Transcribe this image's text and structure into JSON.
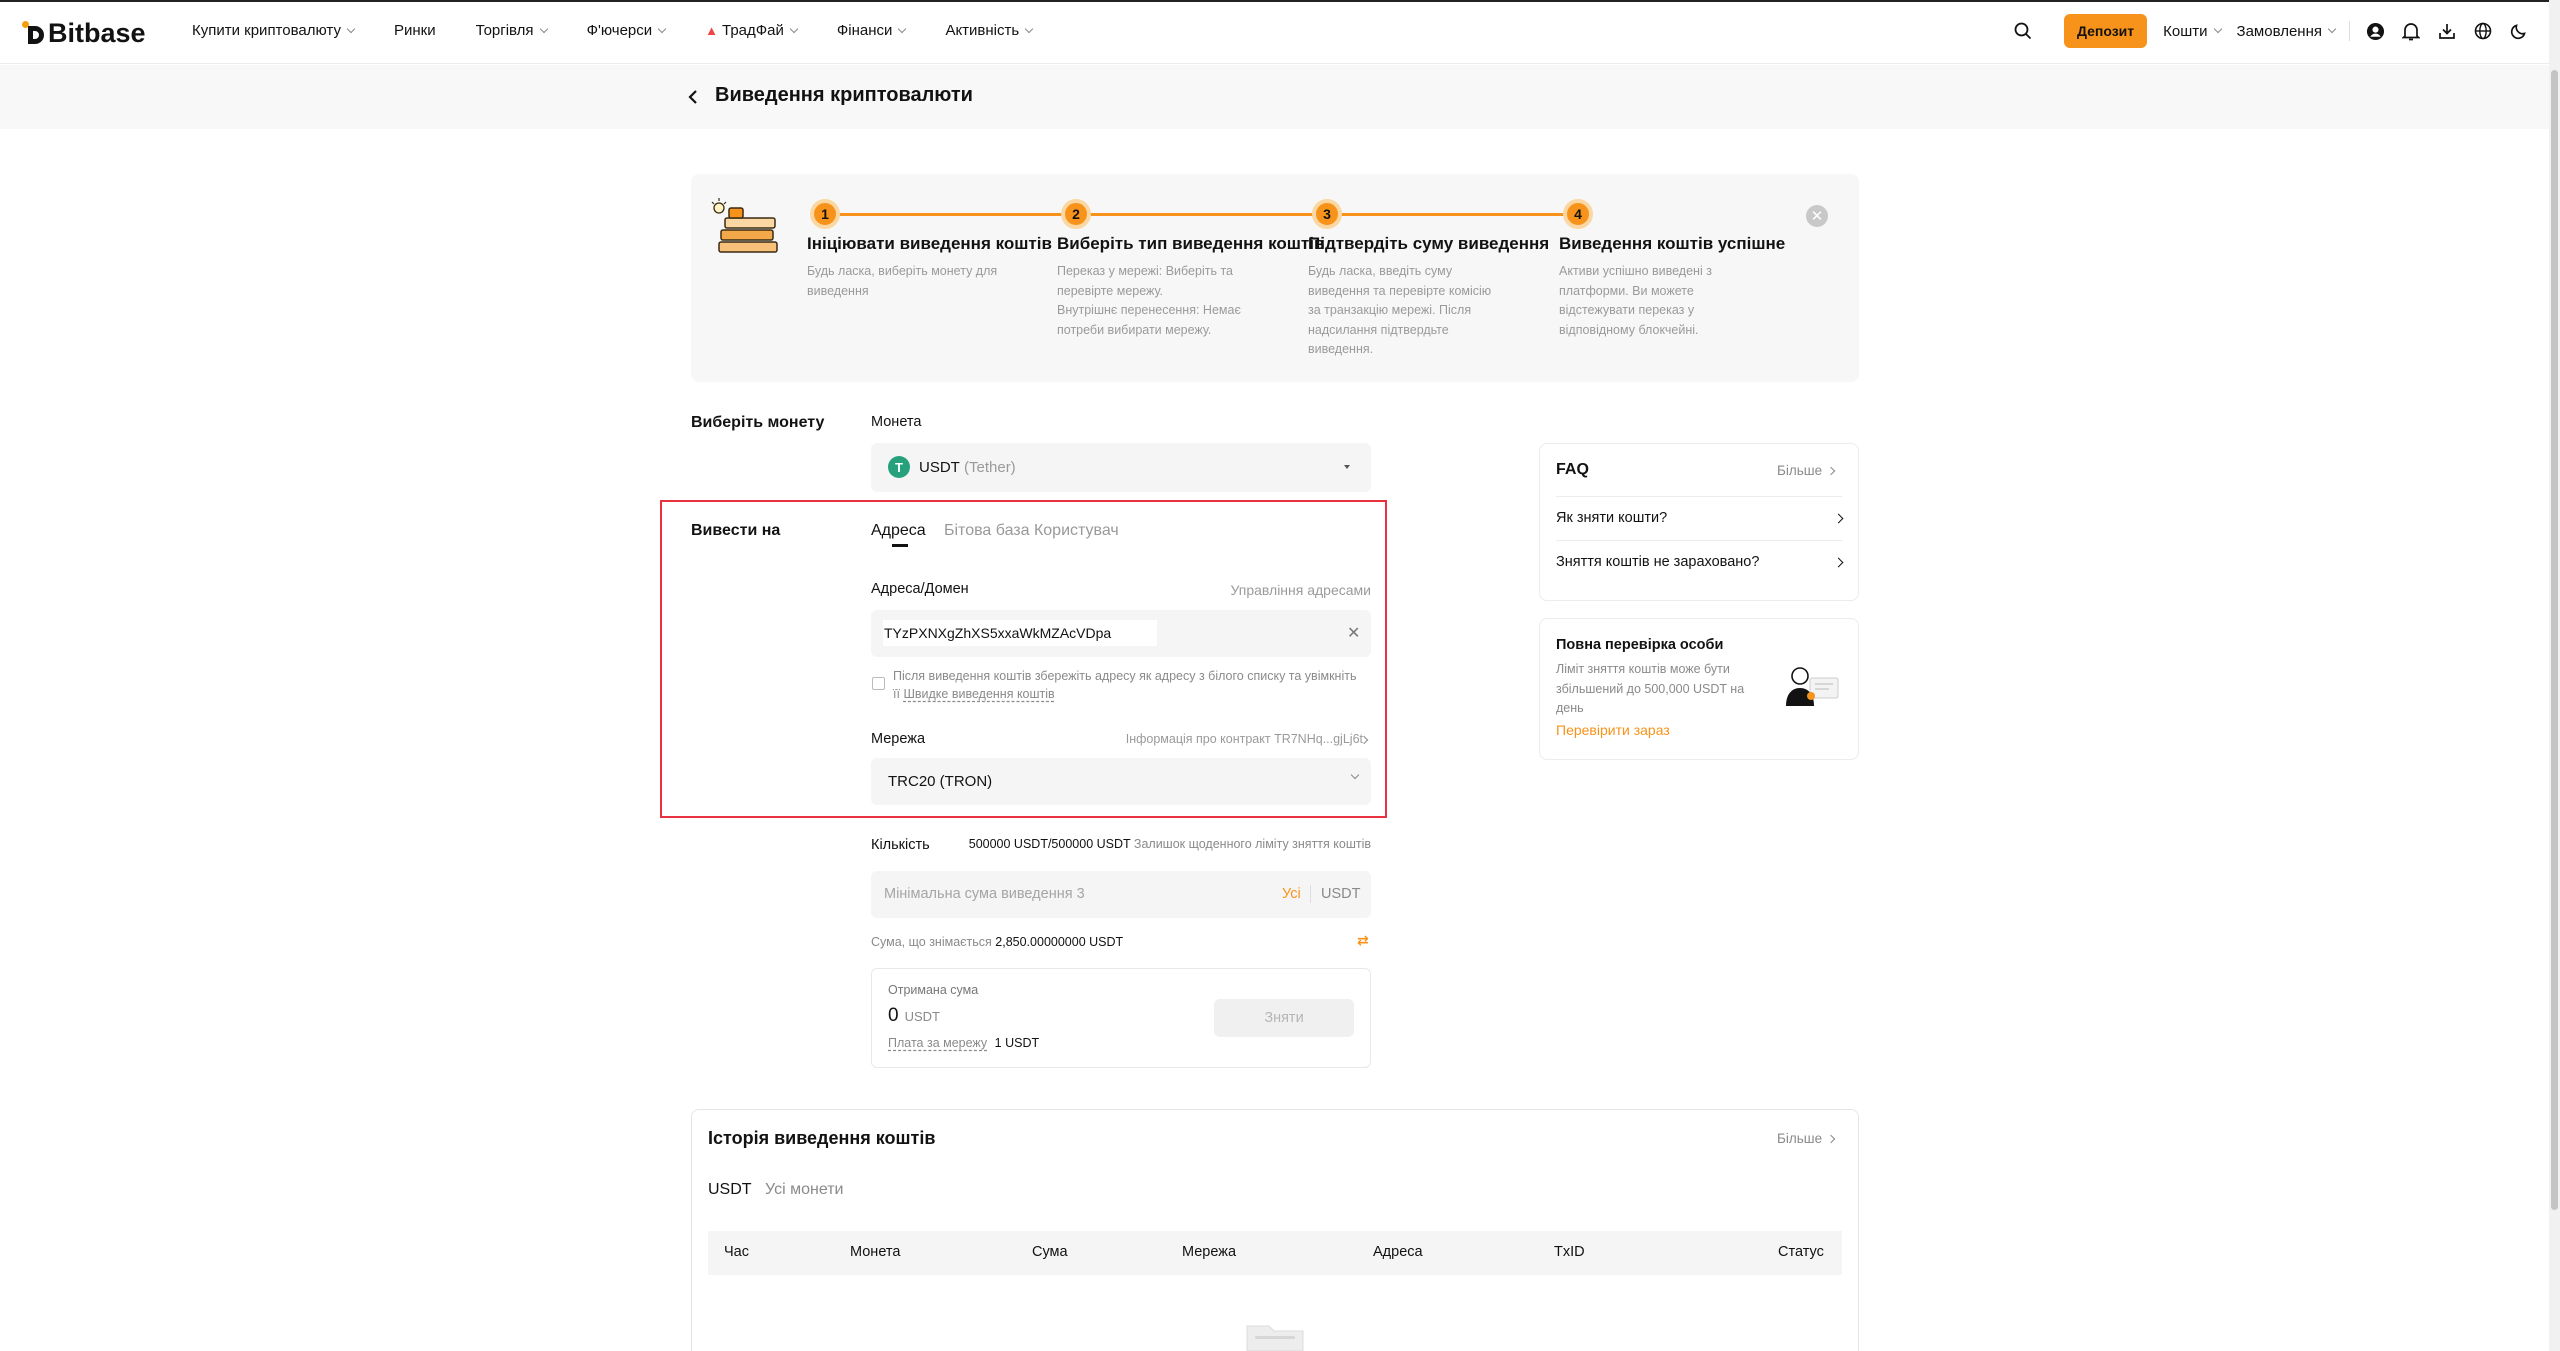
{
  "brand": {
    "name": "Bitbase"
  },
  "nav": {
    "items": [
      {
        "label": "Купити криптовалюту",
        "caret": true
      },
      {
        "label": "Ринки",
        "caret": false
      },
      {
        "label": "Торгівля",
        "caret": true
      },
      {
        "label": "Ф'ючерси",
        "caret": true
      },
      {
        "label": "ТрадФай",
        "caret": true
      },
      {
        "label": "Фінанси",
        "caret": true
      },
      {
        "label": "Активність",
        "caret": true
      }
    ],
    "deposit_label": "Депозит",
    "funds_label": "Кошти",
    "orders_label": "Замовлення"
  },
  "page": {
    "title": "Виведення криптовалюти"
  },
  "steps": [
    {
      "num": "1",
      "title": "Ініціювати виведення коштів",
      "desc": [
        "Будь ласка, виберіть монету для",
        "виведення"
      ]
    },
    {
      "num": "2",
      "title": "Виберіть тип виведення коштів",
      "desc": [
        "Переказ у мережі: Виберіть та",
        "перевірте мережу.",
        "Внутрішнє перенесення: Немає",
        "потреби вибирати мережу."
      ]
    },
    {
      "num": "3",
      "title": "Підтвердіть суму виведення",
      "desc": [
        "Будь ласка, введіть суму",
        "виведення та перевірте комісію",
        "за транзакцію мережі. Після",
        "надсилання підтвердьте",
        "виведення."
      ]
    },
    {
      "num": "4",
      "title": "Виведення коштів успішне",
      "desc": [
        "Активи успішно виведені з",
        "платформи. Ви можете",
        "відстежувати переказ у",
        "відповідному блокчейні."
      ]
    }
  ],
  "coin": {
    "section_label": "Виберіть монету",
    "field_label": "Монета",
    "symbol": "USDT",
    "name": "(Tether)"
  },
  "withdraw_to": {
    "section_label": "Вивести на",
    "tabs": [
      "Адреса",
      "Бітова база Користувач"
    ],
    "address_label": "Адреса/Домен",
    "manage_label": "Управління адресами",
    "address_value": "TYzPXNXgZhXS5xxaWkMZAcVDpa",
    "save_note_1": "Після виведення коштів збережіть адресу як адресу з білого списку та увімкніть",
    "save_note_2": "її",
    "save_note_link": "Швидке виведення коштів",
    "network_label": "Мережа",
    "contract_info": "Інформація про контракт TR7NHq...gjLj6t",
    "network_value": "TRC20 (TRON)"
  },
  "amount": {
    "label": "Кількість",
    "limit_value": "500000 USDT/500000 USDT",
    "limit_text": "Залишок щоденного ліміту зняття коштів",
    "placeholder": "Мінімальна сума виведення 3",
    "all_label": "Усі",
    "unit": "USDT",
    "withdrawable_label": "Сума, що знімається",
    "withdrawable_value": "2,850.00000000 USDT"
  },
  "receive": {
    "label": "Отримана сума",
    "value": "0",
    "unit": "USDT",
    "fee_label": "Плата за мережу",
    "fee_value": "1 USDT",
    "button_label": "Зняти"
  },
  "faq": {
    "title": "FAQ",
    "more_label": "Більше",
    "items": [
      "Як зняти кошти?",
      "Зняття коштів не зараховано?"
    ]
  },
  "kyc": {
    "title": "Повна перевірка особи",
    "desc": [
      "Ліміт зняття коштів може бути",
      "збільшений до 500,000 USDT на",
      "день"
    ],
    "link": "Перевірити зараз"
  },
  "history": {
    "title": "Історія виведення коштів",
    "more_label": "Більше",
    "tabs": [
      "USDT",
      "Усі монети"
    ],
    "columns": [
      "Час",
      "Монета",
      "Сума",
      "Мережа",
      "Адреса",
      "TxID",
      "Статус"
    ]
  },
  "colors": {
    "accent": "#f7931a",
    "highlight_box": "#e8323f",
    "tether": "#26a17b"
  }
}
